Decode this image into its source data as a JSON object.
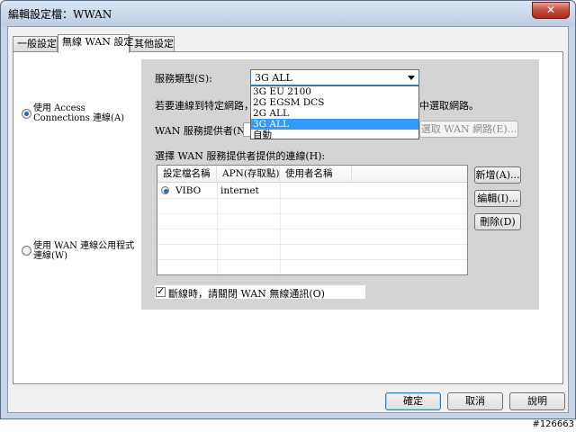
{
  "window": {
    "title": "編輯設定檔：WWAN",
    "close_symbol": "✕"
  },
  "tabs": [
    {
      "label": "一般設定",
      "active": false
    },
    {
      "label": "無線 WAN 設定",
      "active": true
    },
    {
      "label": "其他設定",
      "active": false
    }
  ],
  "connection_mode": {
    "option_access_connections": {
      "label": "使用 Access Connections 連線(A)",
      "checked": true
    },
    "option_wan_utility": {
      "label": "使用 WAN 連線公用程式連線(W)",
      "checked": false
    }
  },
  "service_type": {
    "label": "服務類型(S):",
    "selected": "3G ALL",
    "options": [
      "3G EU 2100",
      "2G EGSM DCS",
      "2G ALL",
      "3G ALL",
      "自動"
    ],
    "highlighted_index": 3
  },
  "network_hint": {
    "text_left": "若要連線到特定網路，取",
    "text_right": "中選取網路。"
  },
  "provider": {
    "label": "WAN 服務提供者(N):",
    "select_network_button": "選取 WAN 網路(E)..."
  },
  "provider_connections": {
    "label": "選擇 WAN 服務提供者提供的連線(H):",
    "columns": [
      "設定檔名稱",
      "APN(存取點)",
      "使用者名稱"
    ],
    "rows": [
      {
        "name": "VIBO",
        "apn": "internet",
        "user": "",
        "selected": true
      }
    ],
    "add_button": "新增(A)...",
    "edit_button": "編輯(I)...",
    "delete_button": "刪除(D)"
  },
  "disconnect_option": {
    "label": "斷線時，請關閉 WAN 無線通訊(O)",
    "checked": true
  },
  "footer": {
    "ok_button": "確定",
    "cancel_button": "取消",
    "help_button": "說明"
  },
  "watermark": "#126663",
  "colors": {
    "selection": "#3399ff",
    "focus_border": "#3c7fb1",
    "radio_dot": "#2a66c4",
    "close_button": "#c75043"
  }
}
